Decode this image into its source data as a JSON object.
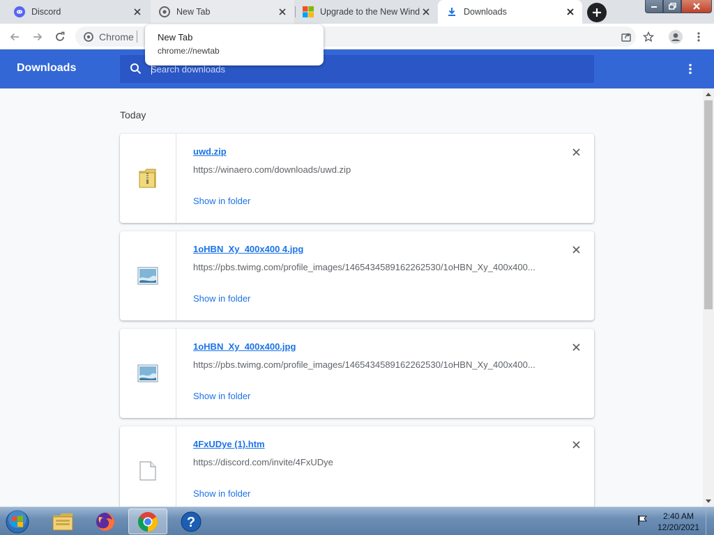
{
  "tabs": [
    {
      "title": "Discord",
      "icon": "discord-icon"
    },
    {
      "title": "New Tab",
      "icon": "chrome-icon"
    },
    {
      "title": "Upgrade to the New Wind",
      "icon": "windows-logo-icon"
    },
    {
      "title": "Downloads",
      "icon": "download-icon"
    }
  ],
  "omnibox": {
    "chip_label": "Chrome"
  },
  "hovercard": {
    "title": "New Tab",
    "url": "chrome://newtab"
  },
  "downloads": {
    "page_title": "Downloads",
    "search_placeholder": "Search downloads",
    "section_label": "Today",
    "items": [
      {
        "name": "uwd.zip",
        "url": "https://winaero.com/downloads/uwd.zip",
        "action": "Show in folder",
        "icon": "zip-folder-icon"
      },
      {
        "name": "1oHBN_Xy_400x400 4.jpg",
        "url": "https://pbs.twimg.com/profile_images/1465434589162262530/1oHBN_Xy_400x400...",
        "action": "Show in folder",
        "icon": "image-file-icon"
      },
      {
        "name": "1oHBN_Xy_400x400.jpg",
        "url": "https://pbs.twimg.com/profile_images/1465434589162262530/1oHBN_Xy_400x400...",
        "action": "Show in folder",
        "icon": "image-file-icon"
      },
      {
        "name": "4FxUDye (1).htm",
        "url": "https://discord.com/invite/4FxUDye",
        "action": "Show in folder",
        "icon": "blank-file-icon"
      }
    ]
  },
  "taskbar": {
    "time": "2:40 AM",
    "date": "12/20/2021",
    "apps": [
      "windows-explorer-icon",
      "firefox-icon",
      "chrome-icon",
      "help-icon"
    ]
  },
  "colors": {
    "header": "#3367d6",
    "link": "#1a73e8"
  }
}
